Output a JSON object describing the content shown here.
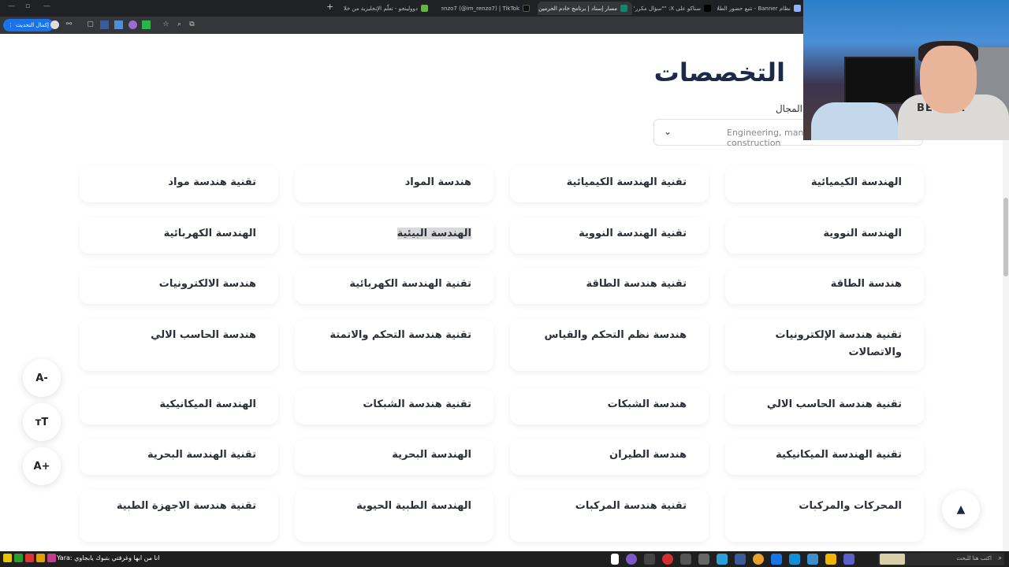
{
  "browser": {
    "tabs": [
      {
        "title": "نظام Banner - تتبع حضور الطلاب",
        "active": false
      },
      {
        "title": "سناكو على X: \"\"سؤال مكرر\" ماذا",
        "active": false
      },
      {
        "title": "مسار إسناد | برنامج خادم الحرمين",
        "active": true
      },
      {
        "title": "renzo7 (@im_renzo7) | TikTok",
        "active": false
      },
      {
        "title": "دوولينجو - تعلّم الإنجليزية من خلا",
        "active": false
      }
    ],
    "update_button": "إكمال التحديث"
  },
  "page": {
    "heading": "التخصصات",
    "field_label": "المجال",
    "field_value": "Engineering, manufacturing and construction",
    "majors": [
      [
        "الهندسة الكيميائية",
        "تقنية الهندسة الكيميائية",
        "هندسة المواد",
        "تقنية هندسة مواد"
      ],
      [
        "الهندسة النووية",
        "تقنية الهندسة النووية",
        "الهندسة البيئية",
        "الهندسة الكهربائية"
      ],
      [
        "هندسة الطاقة",
        "تقنية هندسة الطاقة",
        "تقنية الهندسة الكهربائية",
        "هندسة الالكترونيات"
      ],
      [
        "تقنية هندسة الإلكترونيات والاتصالات",
        "هندسة نظم التحكم والقياس",
        "تقنية هندسة التحكم والاتمتة",
        "هندسة الحاسب الالي"
      ],
      [
        "تقنية هندسة الحاسب الالي",
        "هندسة الشبكات",
        "تقنية هندسة الشبكات",
        "الهندسة الميكانيكية"
      ],
      [
        "تقنية الهندسة الميكانيكية",
        "هندسة الطيران",
        "الهندسة البحرية",
        "تقنية الهندسة البحرية"
      ],
      [
        "المحركات والمركبات",
        "تقنية هندسة المركبات",
        "الهندسة الطبية الحيوية",
        "تقنية هندسة الاجهزة الطبية"
      ]
    ],
    "font_controls": {
      "decrease": "A-",
      "reset": "ᴛT",
      "increase": "A+"
    },
    "back_to_top": "▲"
  },
  "webcam": {
    "shirt_text": "BETTER"
  },
  "taskbar": {
    "ticker": "انا من ابها وغرفتي بتبوك يابجاوي :Yara",
    "search_placeholder": "اكتب هنا للبحث"
  }
}
